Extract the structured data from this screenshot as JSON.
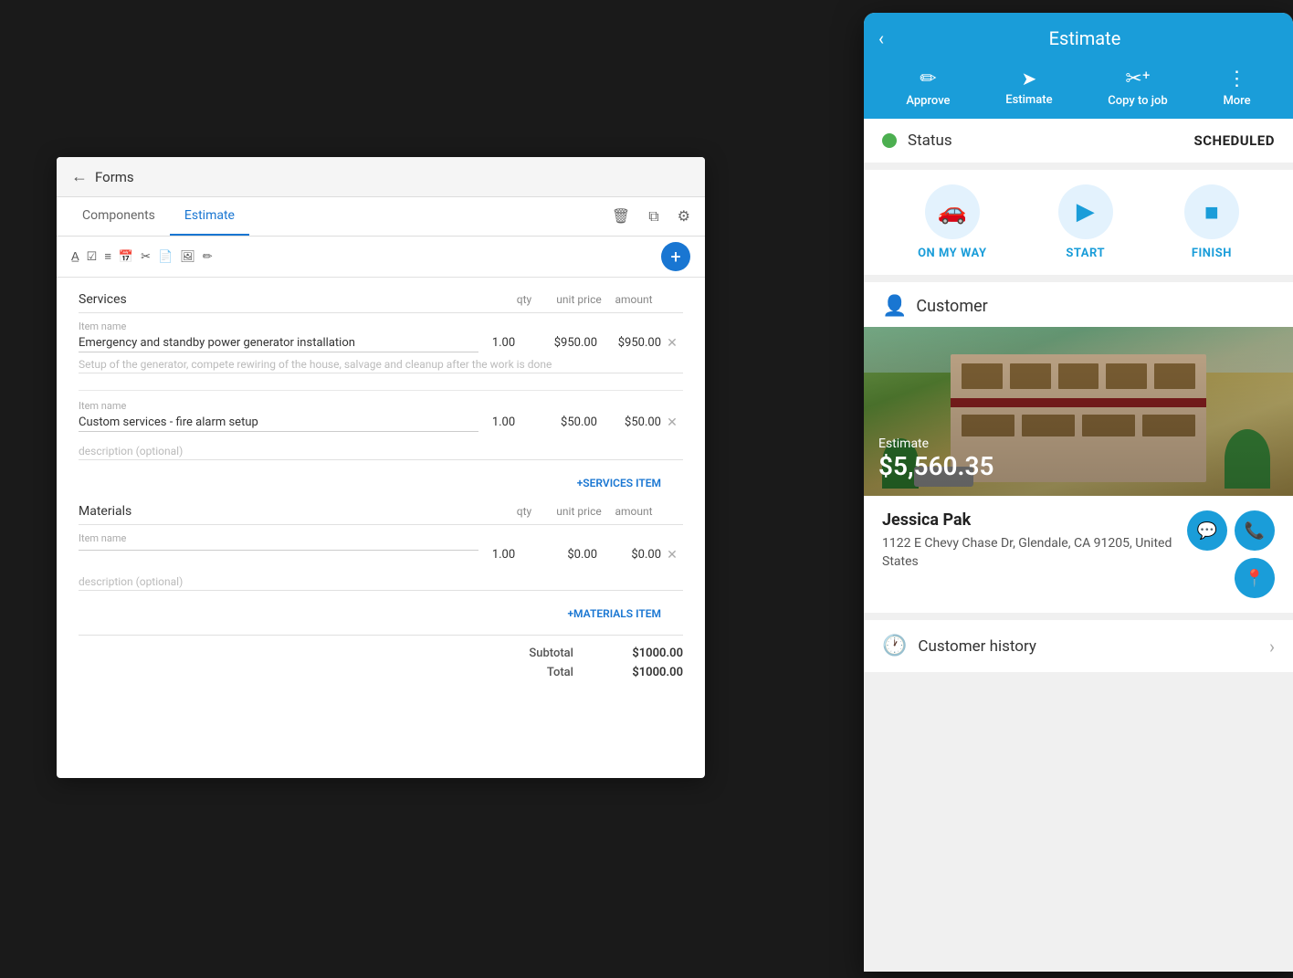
{
  "desktop": {
    "topbar": {
      "back_label": "←",
      "title": "Forms"
    },
    "tabs": {
      "components_label": "Components",
      "estimate_label": "Estimate"
    },
    "services": {
      "section_title": "Services",
      "col_qty": "qty",
      "col_unit_price": "unit price",
      "col_amount": "amount",
      "items": [
        {
          "label": "Item name",
          "name": "Emergency and standby power generator installation",
          "description": "Setup of the generator, compete rewiring of the house, salvage and cleanup after the work is done",
          "qty": "1.00",
          "unit_price": "$950.00",
          "amount": "$950.00"
        },
        {
          "label": "Item name",
          "name": "Custom services - fire alarm setup",
          "description": "description (optional)",
          "qty": "1.00",
          "unit_price": "$50.00",
          "amount": "$50.00"
        }
      ],
      "add_label": "+SERVICES ITEM"
    },
    "materials": {
      "section_title": "Materials",
      "col_qty": "qty",
      "col_unit_price": "unit price",
      "col_amount": "amount",
      "items": [
        {
          "label": "Item name",
          "name": "",
          "description": "description (optional)",
          "qty": "1.00",
          "unit_price": "$0.00",
          "amount": "$0.00"
        }
      ],
      "add_label": "+MATERIALS ITEM"
    },
    "totals": {
      "subtotal_label": "Subtotal",
      "subtotal_value": "$1000.00",
      "total_label": "Total",
      "total_value": "$1000.00"
    }
  },
  "mobile": {
    "header": {
      "title": "Estimate",
      "back_icon": "‹",
      "actions": [
        {
          "id": "approve",
          "icon": "✏️",
          "label": "Approve"
        },
        {
          "id": "estimate",
          "icon": "✈",
          "label": "Estimate"
        },
        {
          "id": "copy_to_job",
          "icon": "✂+",
          "label": "Copy to job"
        },
        {
          "id": "more",
          "icon": "⋮",
          "label": "More"
        }
      ]
    },
    "status": {
      "label": "Status",
      "value": "SCHEDULED",
      "color": "#4caf50"
    },
    "progress": {
      "actions": [
        {
          "id": "on_my_way",
          "icon": "🚗",
          "label": "ON MY WAY"
        },
        {
          "id": "start",
          "icon": "▶",
          "label": "START"
        },
        {
          "id": "finish",
          "icon": "■",
          "label": "FINISH"
        }
      ]
    },
    "customer": {
      "section_title": "Customer",
      "estimate_label": "Estimate",
      "estimate_value": "$5,560.35",
      "name": "Jessica Pak",
      "address": "1122 E Chevy Chase Dr, Glendale, CA 91205, United States"
    },
    "history": {
      "label": "Customer history",
      "arrow": "›"
    }
  }
}
